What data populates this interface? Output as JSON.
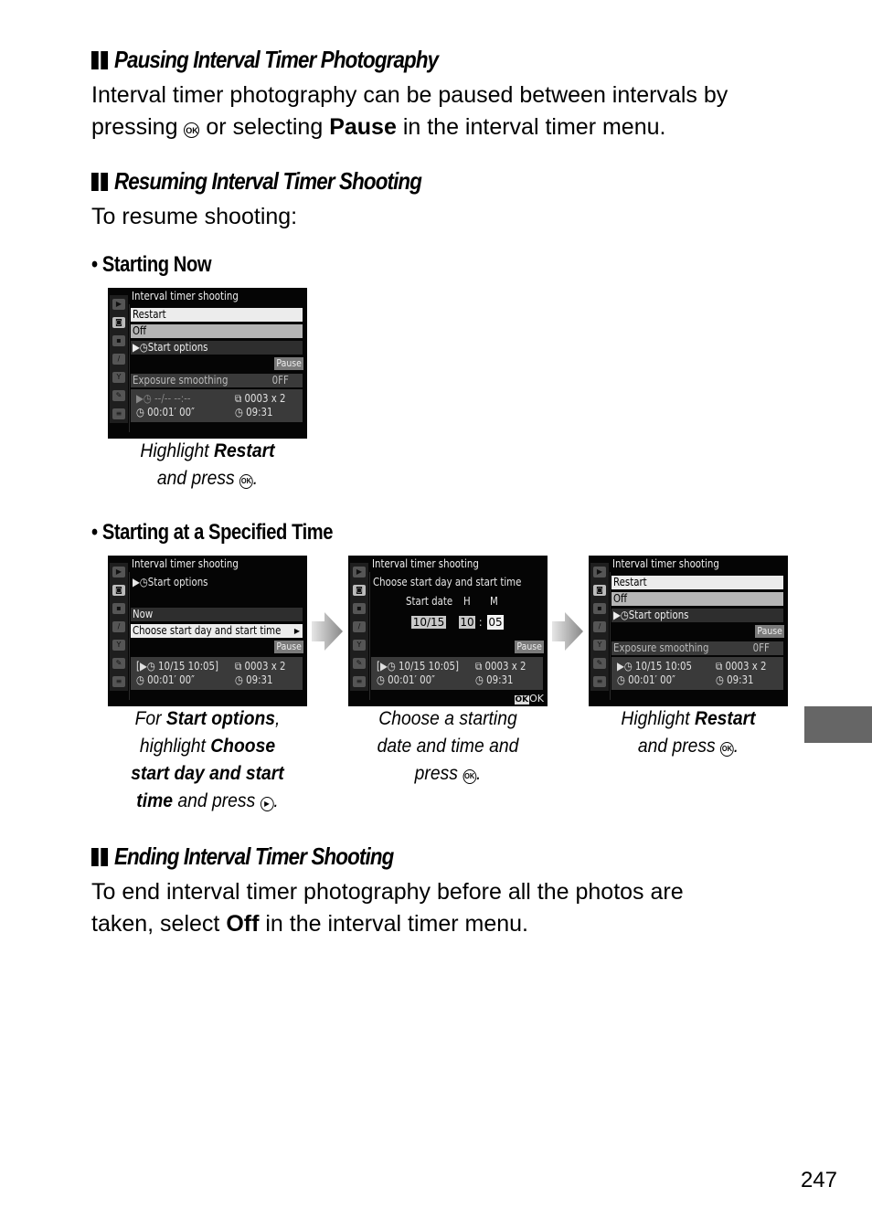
{
  "sections": {
    "pausing": {
      "heading": "Pausing Interval Timer Photography",
      "line1": "Interval timer photography can be paused between intervals by",
      "line2_pre": "pressing ",
      "line2_icon": "OK",
      "line2_mid": " or selecting ",
      "line2_bold": "Pause",
      "line2_post": " in the interval timer menu."
    },
    "resuming": {
      "heading": "Resuming Interval Timer Shooting",
      "intro": "To resume shooting:",
      "starting_now": {
        "bullet": "• Starting Now",
        "caption_pre": "Highlight ",
        "caption_bold": "Restart",
        "caption_line2": "and press ",
        "caption_icon": "OK",
        "caption_end": "."
      },
      "specified_time": {
        "bullet": "• Starting at a Specified Time",
        "captions": [
          {
            "l1_pre": "For ",
            "l1_bold": "Start options",
            "l1_post": ",",
            "l2_pre": "highlight ",
            "l2_bold": "Choose",
            "l3_bold": "start day and start",
            "l4_bold": "time",
            "l4_post": " and press ",
            "l4_icon": "▶",
            "l4_end": "."
          },
          {
            "l1": "Choose a starting",
            "l2": "date and time and",
            "l3_pre": "press ",
            "l3_icon": "OK",
            "l3_end": "."
          },
          {
            "l1_pre": "Highlight ",
            "l1_bold": "Restart",
            "l2_pre": "and press ",
            "l2_icon": "OK",
            "l2_end": "."
          }
        ]
      }
    },
    "ending": {
      "heading": "Ending Interval Timer Shooting",
      "line1": "To end interval timer photography before all the photos are",
      "line2_pre": "taken, select ",
      "line2_bold": "Off",
      "line2_post": " in the interval timer menu."
    }
  },
  "screens": {
    "menu1": {
      "title": "Interval timer shooting",
      "items": [
        "Restart",
        "Off",
        "▶◷Start options"
      ],
      "pause": "Pause",
      "exposure_label": "Exposure smoothing",
      "exposure_value": "0FF",
      "start": "▶◷ --/--  --:--",
      "interval": "◷ 00:01′ 00″",
      "shots": "⧉ 0003 x 2",
      "remaining": "◷ 09:31"
    },
    "menu2": {
      "title": "Interval timer shooting",
      "header": "▶◷Start options",
      "items": [
        "Now",
        "Choose start day and start time"
      ],
      "arrow": "▶",
      "pause": "Pause",
      "start": "[▶◷ 10/15  10:05]",
      "interval": "◷ 00:01′ 00″",
      "shots": "⧉ 0003 x 2",
      "remaining": "◷ 09:31"
    },
    "menu3": {
      "title": "Interval timer shooting",
      "header": "Choose start day and start time",
      "labels": {
        "date": "Start date",
        "hour": "H",
        "minute": "M"
      },
      "values": {
        "date": "10/15",
        "hour": "10",
        "sep": ":",
        "minute": "05"
      },
      "pause": "Pause",
      "start": "[▶◷ 10/15  10:05]",
      "interval": "◷ 00:01′ 00″",
      "shots": "⧉ 0003 x 2",
      "remaining": "◷ 09:31",
      "ok_icon": "OK",
      "ok_label": "OK"
    },
    "menu4": {
      "title": "Interval timer shooting",
      "items": [
        "Restart",
        "Off",
        "▶◷Start options"
      ],
      "pause": "Pause",
      "exposure_label": "Exposure smoothing",
      "exposure_value": "0FF",
      "start": "▶◷ 10/15  10:05",
      "interval": "◷ 00:01′ 00″",
      "shots": "⧉ 0003 x 2",
      "remaining": "◷ 09:31"
    },
    "sidebar_icons": [
      "playback-icon",
      "camera-icon",
      "movie-icon",
      "pencil-icon",
      "wrench-icon",
      "retouch-icon",
      "my-menu-icon"
    ]
  },
  "page_number": "247",
  "colors": {
    "tab": "#666666",
    "screen_bg": "#050505",
    "highlight": "#ececec"
  }
}
